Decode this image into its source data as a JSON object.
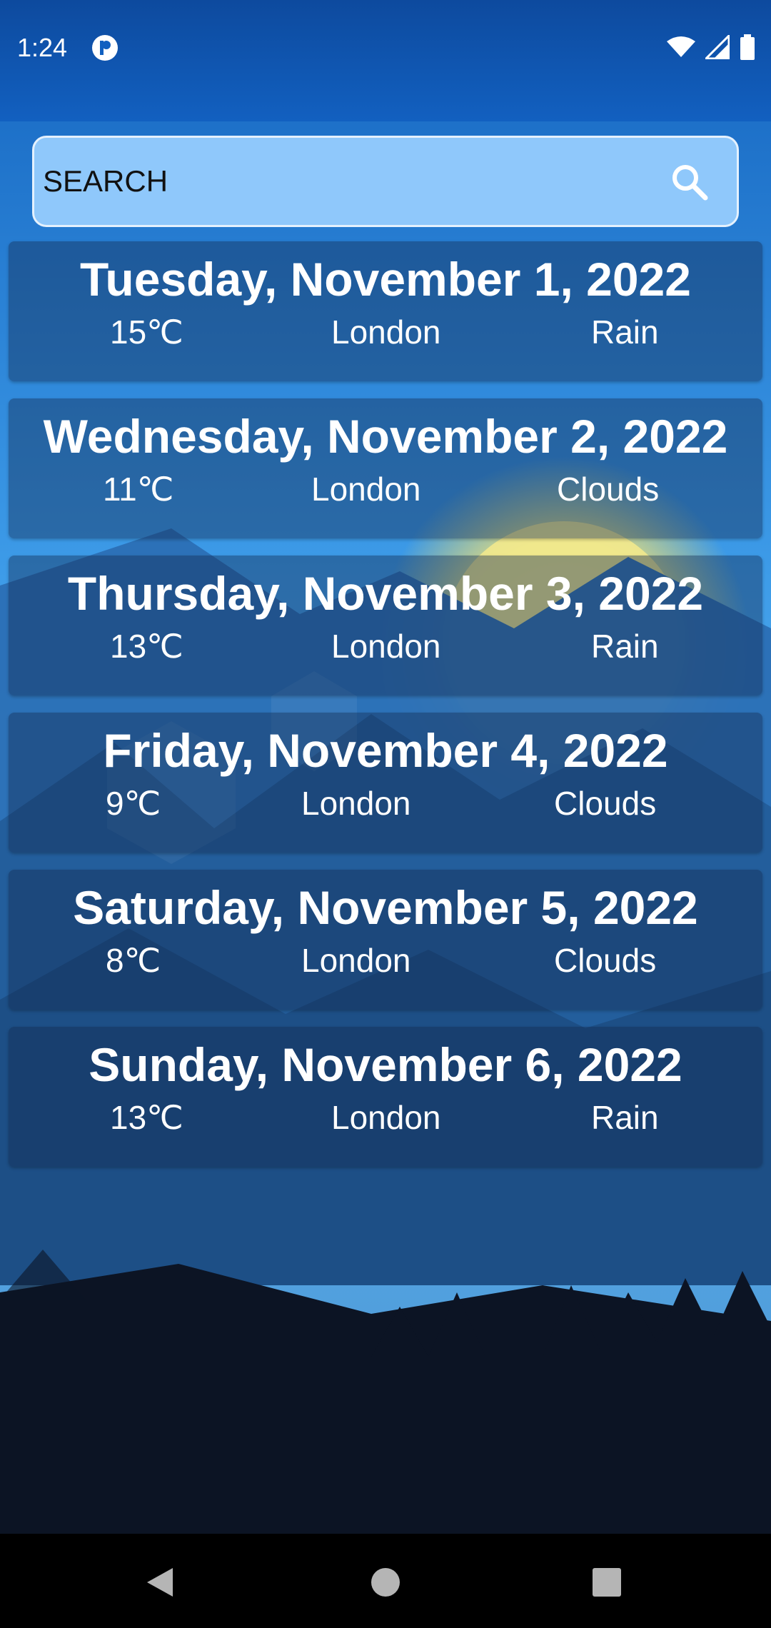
{
  "status_bar": {
    "time": "1:24"
  },
  "search": {
    "placeholder": "SEARCH",
    "icon": "search-icon"
  },
  "forecast": [
    {
      "date": "Tuesday, November 1, 2022",
      "temp": "15℃",
      "city": "London",
      "condition": "Rain"
    },
    {
      "date": "Wednesday, November 2, 2022",
      "temp": "11℃",
      "city": "London",
      "condition": "Clouds"
    },
    {
      "date": "Thursday, November 3, 2022",
      "temp": "13℃",
      "city": "London",
      "condition": "Rain"
    },
    {
      "date": "Friday, November 4, 2022",
      "temp": "9℃",
      "city": "London",
      "condition": "Clouds"
    },
    {
      "date": "Saturday, November 5, 2022",
      "temp": "8℃",
      "city": "London",
      "condition": "Clouds"
    },
    {
      "date": "Sunday, November 6, 2022",
      "temp": "13℃",
      "city": "London",
      "condition": "Rain"
    }
  ],
  "colors": {
    "sky_top": "#1565c0",
    "sky_bottom": "#5ab4ef",
    "sun": "#f3e88a",
    "search_bg": "#8fc8fb"
  }
}
